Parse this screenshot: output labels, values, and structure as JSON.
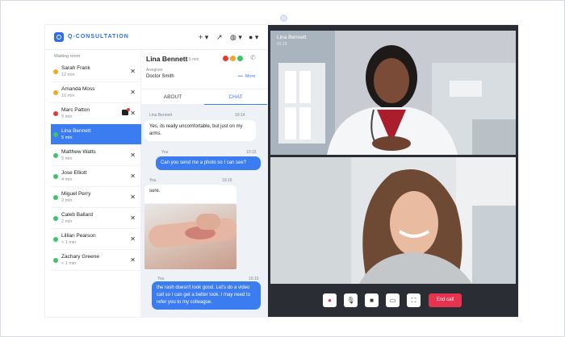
{
  "app": {
    "brand": "Q-CONSULTATION"
  },
  "header": {
    "icons": [
      "plus-icon",
      "share-icon",
      "globe-icon",
      "user-icon"
    ]
  },
  "waiting_room": {
    "title": "Waiting room",
    "patients": [
      {
        "name": "Sarah Frank",
        "time": "12 min",
        "status_color": "#f5a623"
      },
      {
        "name": "Amanda Moss",
        "time": "10 min",
        "status_color": "#f5a623"
      },
      {
        "name": "Marc Patton",
        "time": "9 min",
        "status_color": "#e53935"
      },
      {
        "name": "Lina Bennett",
        "time": "5 min",
        "status_color": "#3ec46d",
        "active": true
      },
      {
        "name": "Matthew Watts",
        "time": "5 min",
        "status_color": "#3ec46d"
      },
      {
        "name": "Jose Elliott",
        "time": "4 min",
        "status_color": "#3ec46d"
      },
      {
        "name": "Miguel Perry",
        "time": "2 min",
        "status_color": "#3ec46d"
      },
      {
        "name": "Caleb Ballard",
        "time": "2 min",
        "status_color": "#3ec46d"
      },
      {
        "name": "Lillian Pearson",
        "time": "< 1 min",
        "status_color": "#3ec46d"
      },
      {
        "name": "Zachary Greene",
        "time": "< 1 min",
        "status_color": "#3ec46d"
      }
    ]
  },
  "chat": {
    "patient_name": "Lina Bennett",
    "patient_time": "5 min",
    "assignee_label": "Assignee",
    "assignee": "Doctor Smith",
    "more": "More",
    "tabs": [
      "ABOUT",
      "CHAT"
    ],
    "messages": [
      {
        "from": "Lina Bennett",
        "time": "10:14",
        "text": "Yes, its really uncomfortable, but just on my arms."
      },
      {
        "from": "You",
        "time": "10:15",
        "text": "Can you send me a photo so I can see?"
      },
      {
        "from": "You",
        "time": "10:15",
        "text": "sure."
      },
      {
        "from": "You",
        "time": "10:15",
        "text": "the rash doesn't look good. Let's do a video call so I can get a better look. I may need to refer you to my colleague."
      }
    ]
  },
  "video": {
    "caller_name": "Lina Bennett",
    "caller_time": "01:15",
    "controls": [
      "record-icon",
      "microphone-icon",
      "camera-icon",
      "screen-share-icon",
      "fullscreen-icon"
    ],
    "end_call": "End call"
  }
}
